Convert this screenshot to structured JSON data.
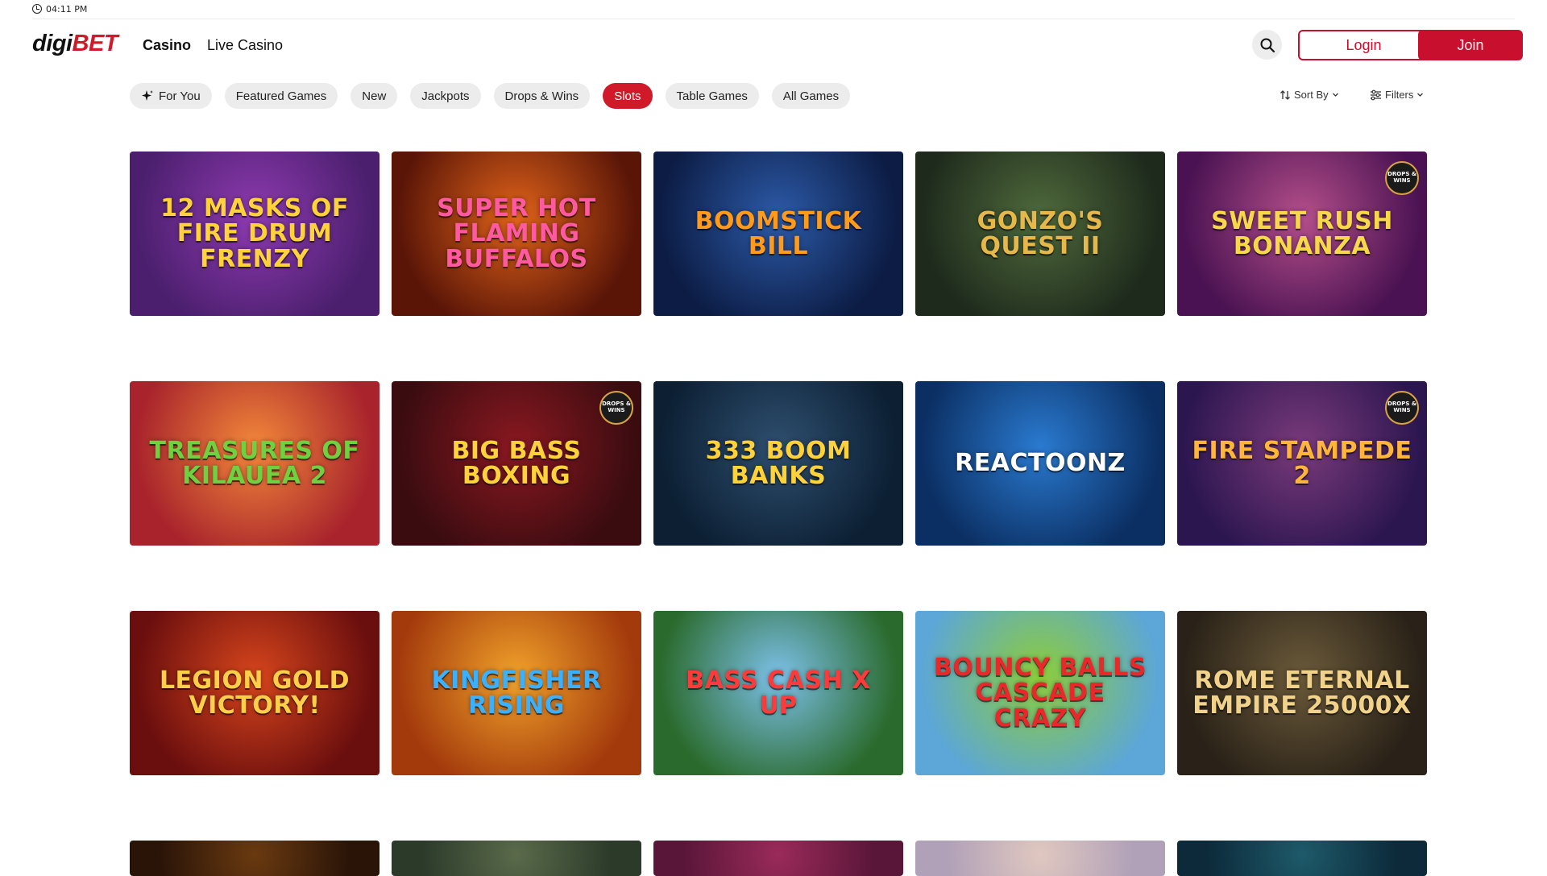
{
  "status": {
    "time": "04:11 PM"
  },
  "brand": {
    "logo_prefix": "digi",
    "logo_suffix": "BET"
  },
  "nav": {
    "items": [
      {
        "label": "Casino"
      },
      {
        "label": "Live Casino"
      }
    ]
  },
  "header": {
    "login_label": "Login",
    "join_label": "Join"
  },
  "filters": {
    "chips": [
      {
        "label": "For You"
      },
      {
        "label": "Featured Games"
      },
      {
        "label": "New"
      },
      {
        "label": "Jackpots"
      },
      {
        "label": "Drops & Wins"
      },
      {
        "label": "Slots"
      },
      {
        "label": "Table Games"
      },
      {
        "label": "All Games"
      }
    ],
    "active": "Slots",
    "sort_label": "Sort By",
    "filters_label": "Filters"
  },
  "badge_text": "DROPS & WINS",
  "games": [
    {
      "title": "12 Masks of Fire Drum Frenzy",
      "colors": [
        "#4b1f6e",
        "#8e3ab0"
      ],
      "accent": "#ffd23a"
    },
    {
      "title": "Super Hot Flaming Buffalos",
      "colors": [
        "#5a1507",
        "#e0631a"
      ],
      "accent": "#ff5aa0"
    },
    {
      "title": "Boomstick Bill",
      "colors": [
        "#0c1c44",
        "#2c5aa8"
      ],
      "accent": "#ff9a1a"
    },
    {
      "title": "Gonzo's Quest II",
      "colors": [
        "#1e2a1c",
        "#4f6a3c"
      ],
      "accent": "#e6b84a"
    },
    {
      "title": "Sweet Rush Bonanza",
      "colors": [
        "#4a1252",
        "#b44f8a"
      ],
      "accent": "#f7d84a"
    },
    {
      "title": "Treasures of Kilauea 2",
      "colors": [
        "#a8232c",
        "#f2883a"
      ],
      "accent": "#6fd040"
    },
    {
      "title": "Big Bass Boxing",
      "colors": [
        "#3a0c10",
        "#8a1820"
      ],
      "accent": "#ffd23a"
    },
    {
      "title": "333 Boom Banks",
      "colors": [
        "#0c1f33",
        "#2e4f6f"
      ],
      "accent": "#ffd23a"
    },
    {
      "title": "Reactoonz",
      "colors": [
        "#0b2f63",
        "#2a7ad0"
      ],
      "accent": "#ffffff"
    },
    {
      "title": "Fire Stampede 2",
      "colors": [
        "#2c1650",
        "#7a3a7a"
      ],
      "accent": "#ffb53a"
    },
    {
      "title": "Legion Gold Victory!",
      "colors": [
        "#6a0e0e",
        "#d6451c"
      ],
      "accent": "#ffcf4a"
    },
    {
      "title": "Kingfisher Rising",
      "colors": [
        "#a33a0c",
        "#f0a12a"
      ],
      "accent": "#3ab0ff"
    },
    {
      "title": "Bass Cash X Up",
      "colors": [
        "#2a6a2c",
        "#7cc0e8"
      ],
      "accent": "#ff3a3a"
    },
    {
      "title": "Bouncy Balls Cascade Crazy",
      "colors": [
        "#5ca6d8",
        "#8ccd3a"
      ],
      "accent": "#e8282a"
    },
    {
      "title": "Rome Eternal Empire 25000X",
      "colors": [
        "#2a2218",
        "#6b5a3a"
      ],
      "accent": "#f0d28a"
    },
    {
      "title": "",
      "colors": [
        "#2a1408",
        "#6a3a10"
      ],
      "accent": "#f0c040"
    },
    {
      "title": "",
      "colors": [
        "#2c3a2a",
        "#5a6a4a"
      ],
      "accent": "#ffffff"
    },
    {
      "title": "",
      "colors": [
        "#5a1638",
        "#9a2a5a"
      ],
      "accent": "#ffffff"
    },
    {
      "title": "",
      "colors": [
        "#b0a0b8",
        "#e0c8c0"
      ],
      "accent": "#ffffff"
    },
    {
      "title": "",
      "colors": [
        "#0c2a3a",
        "#1e5a6a"
      ],
      "accent": "#ffffff"
    }
  ]
}
